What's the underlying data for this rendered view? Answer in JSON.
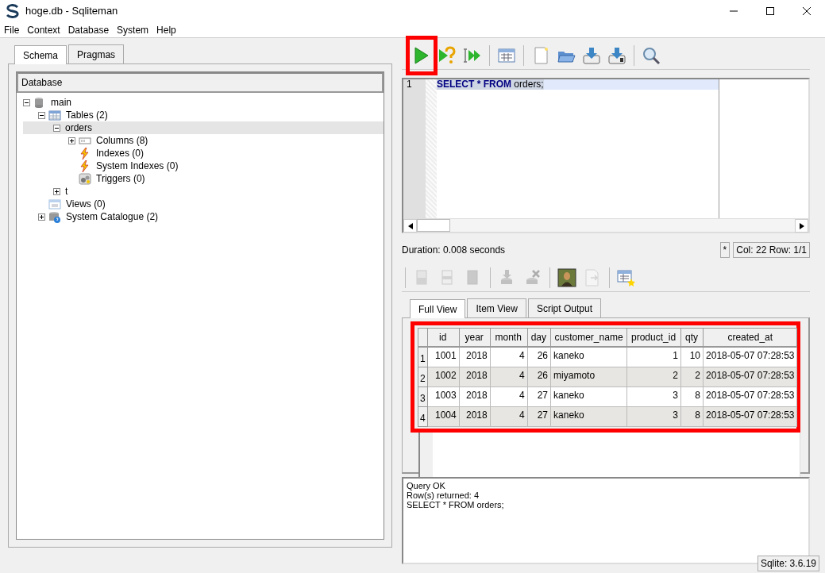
{
  "window": {
    "title": "hoge.db - Sqliteman"
  },
  "menu": [
    "File",
    "Context",
    "Database",
    "System",
    "Help"
  ],
  "left_tabs": [
    {
      "label": "Schema",
      "selected": true
    },
    {
      "label": "Pragmas",
      "selected": false
    }
  ],
  "tree": {
    "header": "Database",
    "items": [
      {
        "label": "main",
        "kind": "database",
        "expanded": true,
        "selected": false,
        "children": [
          {
            "label": "Tables (2)",
            "kind": "tables",
            "expanded": true,
            "selected": false,
            "children": [
              {
                "label": "orders",
                "expanded": true,
                "selected": true,
                "children": [
                  {
                    "label": "Columns (8)",
                    "kind": "columns",
                    "expanded": false,
                    "selected": false
                  },
                  {
                    "label": "Indexes (0)",
                    "kind": "indexes",
                    "selected": false
                  },
                  {
                    "label": "System Indexes (0)",
                    "kind": "indexes",
                    "selected": false
                  },
                  {
                    "label": "Triggers (0)",
                    "kind": "triggers",
                    "selected": false
                  }
                ]
              },
              {
                "label": "t",
                "expanded": false,
                "selected": false
              }
            ]
          },
          {
            "label": "Views (0)",
            "kind": "views",
            "selected": false
          },
          {
            "label": "System Catalogue (2)",
            "kind": "catalogue",
            "expanded": false,
            "selected": false
          }
        ]
      }
    ]
  },
  "toolbar": [
    {
      "kind": "run",
      "highlighted": true,
      "disabled": false
    },
    {
      "kind": "explain",
      "highlighted": false,
      "disabled": false
    },
    {
      "kind": "run-script",
      "highlighted": false,
      "disabled": false
    },
    {
      "kind": "sep"
    },
    {
      "kind": "grid",
      "highlighted": false,
      "disabled": false
    },
    {
      "kind": "sep"
    },
    {
      "kind": "new",
      "highlighted": false,
      "disabled": false
    },
    {
      "kind": "open",
      "highlighted": false,
      "disabled": false
    },
    {
      "kind": "save",
      "highlighted": false,
      "disabled": false
    },
    {
      "kind": "save-as",
      "highlighted": false,
      "disabled": false
    },
    {
      "kind": "sep"
    },
    {
      "kind": "search",
      "highlighted": false,
      "disabled": false
    }
  ],
  "editor": {
    "lines": [
      {
        "number": "1",
        "current": true,
        "tokens": [
          {
            "text": "SELECT * FROM",
            "kind": "keyword"
          },
          {
            "text": "orders;",
            "kind": "plain"
          }
        ]
      }
    ]
  },
  "duration": "Duration: 0.008 seconds",
  "modified_mark": "*",
  "cursor_position": "Col: 22 Row: 1/1",
  "result_toolbar": [
    {
      "kind": "sep"
    },
    {
      "kind": "doc-new",
      "disabled": true
    },
    {
      "kind": "doc",
      "disabled": true
    },
    {
      "kind": "doc-full",
      "disabled": true
    },
    {
      "kind": "sep"
    },
    {
      "kind": "db-down",
      "disabled": true
    },
    {
      "kind": "db-delete",
      "disabled": true
    },
    {
      "kind": "sep"
    },
    {
      "kind": "picture",
      "disabled": false
    },
    {
      "kind": "export",
      "disabled": true
    },
    {
      "kind": "sep"
    },
    {
      "kind": "grid-star",
      "disabled": false
    }
  ],
  "result_tabs": [
    {
      "label": "Full View",
      "selected": true
    },
    {
      "label": "Item View",
      "selected": false
    },
    {
      "label": "Script Output",
      "selected": false
    }
  ],
  "results": {
    "highlighted": true,
    "columns": [
      {
        "label": "id",
        "numeric": true
      },
      {
        "label": "year",
        "numeric": true
      },
      {
        "label": "month",
        "numeric": true
      },
      {
        "label": "day",
        "numeric": true
      },
      {
        "label": "customer_name",
        "numeric": false
      },
      {
        "label": "product_id",
        "numeric": true
      },
      {
        "label": "qty",
        "numeric": true
      },
      {
        "label": "created_at",
        "numeric": false
      }
    ],
    "rows": [
      {
        "number": "1",
        "cells": [
          "1001",
          "2018",
          "4",
          "26",
          "kaneko",
          "1",
          "10",
          "2018-05-07 07:28:53"
        ]
      },
      {
        "number": "2",
        "cells": [
          "1002",
          "2018",
          "4",
          "26",
          "miyamoto",
          "2",
          "2",
          "2018-05-07 07:28:53"
        ]
      },
      {
        "number": "3",
        "cells": [
          "1003",
          "2018",
          "4",
          "27",
          "kaneko",
          "3",
          "8",
          "2018-05-07 07:28:53"
        ]
      },
      {
        "number": "4",
        "cells": [
          "1004",
          "2018",
          "4",
          "27",
          "kaneko",
          "3",
          "8",
          "2018-05-07 07:28:53"
        ]
      }
    ]
  },
  "output": [
    "Query OK",
    "Row(s) returned: 4",
    "SELECT * FROM orders;"
  ],
  "status": "Sqlite: 3.6.19"
}
